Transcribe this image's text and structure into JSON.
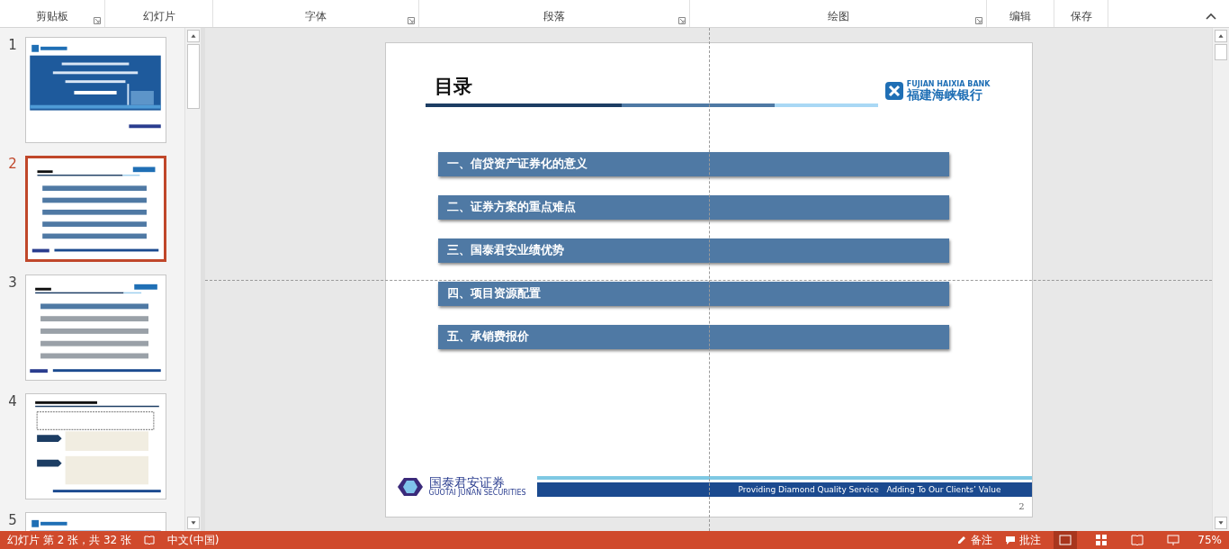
{
  "ribbon": {
    "groups": [
      {
        "label": "剪贴板",
        "launcher": true
      },
      {
        "label": "幻灯片",
        "launcher": false
      },
      {
        "label": "字体",
        "launcher": true
      },
      {
        "label": "段落",
        "launcher": true
      },
      {
        "label": "绘图",
        "launcher": true
      },
      {
        "label": "编辑",
        "launcher": false
      },
      {
        "label": "保存",
        "launcher": false
      }
    ]
  },
  "thumbnails": [
    {
      "number": "1",
      "selected": false,
      "kind": "title"
    },
    {
      "number": "2",
      "selected": true,
      "kind": "toc"
    },
    {
      "number": "3",
      "selected": false,
      "kind": "section"
    },
    {
      "number": "4",
      "selected": false,
      "kind": "content"
    },
    {
      "number": "5",
      "selected": false,
      "kind": "title"
    }
  ],
  "slide": {
    "title": "目录",
    "bank_logo_en": "FUJIAN HAIXIA BANK",
    "bank_logo_cn": "福建海峡银行",
    "items": [
      "一、信贷资产证券化的意义",
      "二、证券方案的重点难点",
      "三、国泰君安业绩优势",
      "四、项目资源配置",
      "五、承销费报价"
    ],
    "footer_logo_cn": "国泰君安证券",
    "footer_logo_en": "GUOTAI JUNAN SECURITIES",
    "slogan": "Providing Diamond Quality Service   Adding To Our Clients’ Value",
    "page_number": "2"
  },
  "status_bar": {
    "slide_info": "幻灯片 第 2 张，共 32 张",
    "language": "中文(中国)",
    "notes": "备注",
    "comments": "批注",
    "views": [
      {
        "kind": "normal",
        "selected": true
      },
      {
        "kind": "sorter",
        "selected": false
      },
      {
        "kind": "reading",
        "selected": false
      },
      {
        "kind": "slideshow",
        "selected": false
      }
    ],
    "zoom": "75%"
  }
}
